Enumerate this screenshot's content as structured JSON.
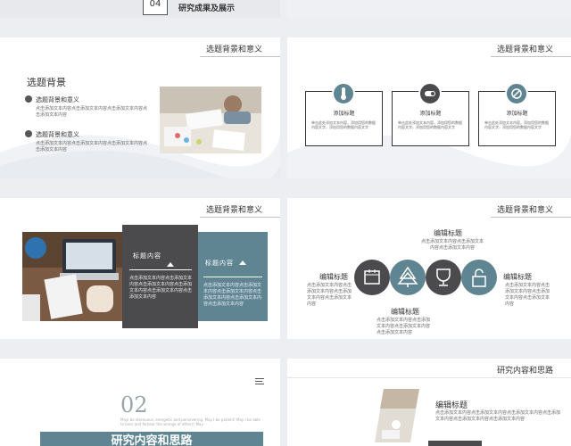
{
  "slide0": {
    "number": "04",
    "title": "研究成果及展示"
  },
  "slide1": {
    "header": "选题背景和意义",
    "heading": "选题背景",
    "items": [
      {
        "title": "选题背景和意义",
        "text": "点击添加文本内容点击添加文本内容点击添加文本内容点击添加文本内容"
      },
      {
        "title": "选题背景和意义",
        "text": "点击添加文本内容点击添加文本内容点击添加文本内容点击添加文本内容"
      }
    ]
  },
  "slide2": {
    "header": "选题背景和意义",
    "cards": [
      {
        "icon": "thermometer-icon",
        "title": "添加标题",
        "text": "单击此处添加文本内容，添加用您的数据内容文字，添加用您的数据内容文字"
      },
      {
        "icon": "toggle-icon",
        "title": "添加标题",
        "text": "单击此处添加文本内容，添加用您的数据内容文字，添加用您的数据内容文字"
      },
      {
        "icon": "compass-icon",
        "title": "添加标题",
        "text": "单击此处添加文本内容，添加用您的数据内容文字，添加用您的数据内容文字"
      }
    ]
  },
  "slide3": {
    "header": "选题背景和意义",
    "boxes": [
      {
        "title": "标题内容",
        "text": "点击添加文本内容点击添加文本内容点击添加文本内容点击添加文本内容点击添加文本内容点击添加文本内容"
      },
      {
        "title": "标题内容",
        "text": "点击添加文本内容点击添加文本内容点击添加文本内容点击添加文本内容点击添加文本内容点击添加文本内容"
      }
    ]
  },
  "slide4": {
    "header": "选题背景和意义",
    "labels": [
      {
        "title": "编辑标题",
        "text": "点击添加文本内容点击添加文本内容点击添加文本内容"
      },
      {
        "title": "编辑标题",
        "text": "点击添加文本内容点击添加文本内容点击添加文本内容点击添加文本内容"
      },
      {
        "title": "编辑标题",
        "text": "点击添加文本内容点击添加文本内容点击添加文本内容点击添加文本内容"
      },
      {
        "title": "编辑标题",
        "text": "点击添加文本内容点击添加文本内容点击添加文本内容点击添加文本内容"
      }
    ],
    "icons": [
      "calendar-icon",
      "tree-icon",
      "trophy-icon",
      "lock-icon"
    ]
  },
  "slide5": {
    "number": "02",
    "subtitle": "Mayi be strenuous, energetic and persevering. May I be patient! May I be able to bear and forbear the wrongs of others! May",
    "title": "研究内容和思路"
  },
  "slide6": {
    "header": "研究内容和思路",
    "title": "编辑标题",
    "text": "点击添加文本内容点击添加文本内容点击添加文本内容点击添加文本内容点击添加文本内容点击添加文本内容"
  },
  "colors": {
    "accent": "#5e8591",
    "dark": "#4b4b4d"
  }
}
